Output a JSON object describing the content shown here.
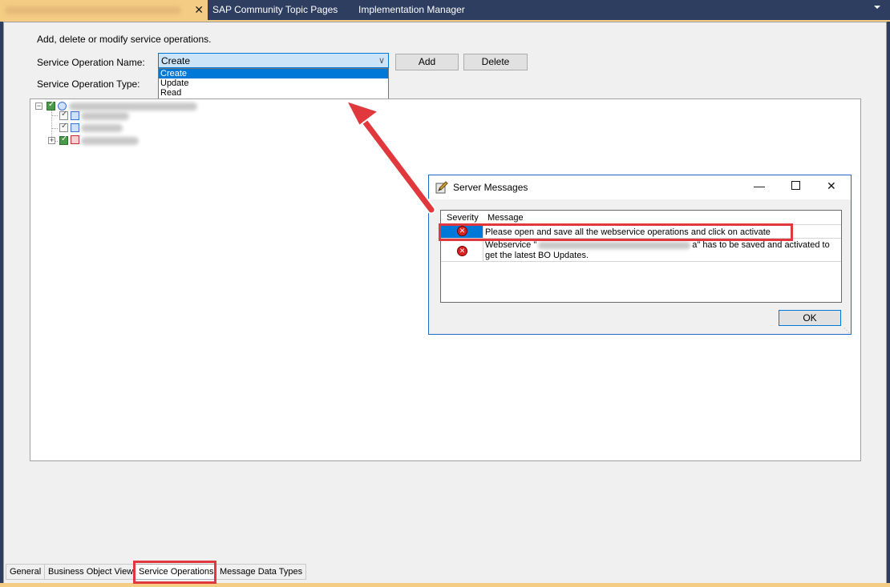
{
  "tabs": {
    "active_close": "✕",
    "tab2": "SAP Community Topic Pages",
    "tab3": "Implementation Manager"
  },
  "form": {
    "intro": "Add, delete or modify service operations.",
    "name_label": "Service Operation Name:",
    "type_label": "Service Operation Type:",
    "combo_value": "Create",
    "dropdown_options": [
      "Create",
      "Update",
      "Read"
    ],
    "add_label": "Add",
    "delete_label": "Delete"
  },
  "bottom_tabs": [
    "General",
    "Business Object View",
    "Service Operations",
    "Message Data Types"
  ],
  "dialog": {
    "title": "Server Messages",
    "col_severity": "Severity",
    "col_message": "Message",
    "row1_message": "Please open and save all the webservice operations and click on activate",
    "row2_prefix": "Webservice \"",
    "row2_suffix": "a\" has to be saved and activated to",
    "row2_line2": "get the latest BO Updates.",
    "ok_label": "OK"
  },
  "colors": {
    "accent": "#f5cc84",
    "selection": "#0078d7",
    "annotation": "#e0383d",
    "tab_strip": "#2d3e60"
  }
}
